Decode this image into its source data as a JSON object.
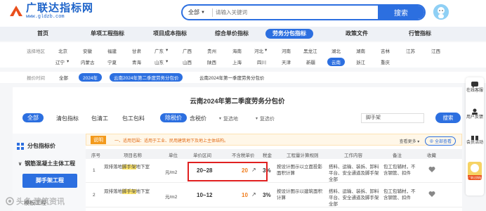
{
  "header": {
    "logo_title": "广联达指标网",
    "logo_url": "www.gldzb.com",
    "search_select": "全部",
    "search_placeholder": "请输入关键词",
    "search_button": "搜索"
  },
  "mainnav": [
    "首页",
    "单项工程指标",
    "项目成本指标",
    "综合单价指标",
    "劳务分包指标",
    "政策文件",
    "行管指标"
  ],
  "mainnav_active": "劳务分包指标",
  "region": {
    "label": "选择地区",
    "row1": [
      "北京",
      "安徽",
      "福建",
      "甘肃",
      "广东",
      "广西",
      "贵州",
      "海南",
      "河北",
      "河南",
      "黑龙江",
      "湖北",
      "湖南",
      "吉林",
      "江苏",
      "江西"
    ],
    "row2": [
      "辽宁",
      "内蒙古",
      "宁夏",
      "青海",
      "山东",
      "山西",
      "陕西",
      "上海",
      "四川",
      "天津",
      "新疆",
      "云南",
      "浙江",
      "重庆"
    ],
    "active": "云南"
  },
  "period": {
    "label": "报价时间",
    "chips": [
      "全部",
      "2024年",
      "云南2024年第二季度劳务分包价",
      "云南2024年第一季度劳务分包价"
    ],
    "active": [
      "2024年",
      "云南2024年第二季度劳务分包价"
    ]
  },
  "card_title": "云南2024年第二季度劳务分包价",
  "tabs": [
    "全部",
    "清包指标",
    "包清工",
    "包工包料"
  ],
  "tabs_active": "全部",
  "price_tabs": [
    "除税价",
    "含税价"
  ],
  "price_tabs_active": "除税价",
  "region_select": "复选地",
  "price_select": "复选价",
  "sub_input": "脚手架",
  "sub_button": "搜索",
  "sidebar": {
    "head": "分包指标价",
    "sub": "钢筋混凝土主体工程",
    "active": "脚手架工程",
    "more": "模板工程"
  },
  "notice": {
    "tag": "说明",
    "text": "一、适用范围：适用于工业、民用建筑地下及地上主体结构。",
    "sort": "查看更多",
    "compare": "全部查看"
  },
  "table": {
    "headers": [
      "序号",
      "项目名称",
      "单位",
      "单价区间",
      "不含税单价",
      "税金",
      "工程量计算规则",
      "工作内容",
      "备注",
      "收藏"
    ],
    "rows": [
      {
        "index": "1",
        "name_pre": "双排落地",
        "name_hl": "脚手架",
        "name_post": "地下室",
        "unit": "元/m2",
        "range": "20~28",
        "price": "20",
        "tax": "3%",
        "rule": "按设计图示以立面投影面积计算",
        "work": "搭料、运输、装拆、卸料平台、安全通道及脚手架全部",
        "remark": "包工包辅材，不含钢管、扣件"
      },
      {
        "index": "2",
        "name_pre": "双排落地",
        "name_hl": "脚手架",
        "name_post": "地下室",
        "unit": "元/m2",
        "range": "10~12",
        "price": "10",
        "tax": "3%",
        "rule": "按设计图示以建筑面积计算",
        "work": "搭料、运输、装拆、卸料平台、安全通道及脚手架全部",
        "remark": "包工包辅材，不含钢管、扣件"
      }
    ]
  },
  "float": [
    "在线客服",
    "用户反馈",
    "会员活动",
    "广联达指标"
  ],
  "watermark": "头条 建筑资讯",
  "colors": {
    "brand": "#2c6fe0",
    "highlight_box": "#e02020",
    "price_orange": "#f07b1a"
  }
}
